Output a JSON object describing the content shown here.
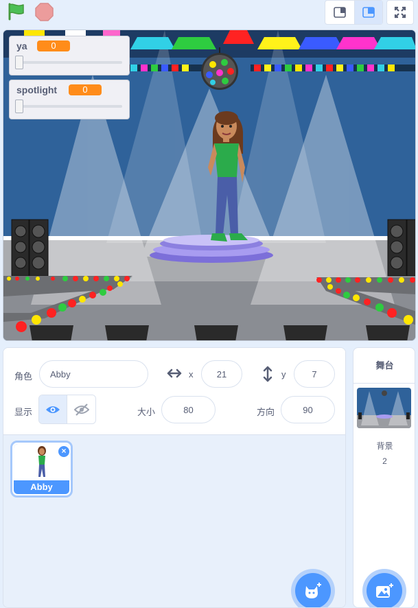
{
  "controls": {
    "flag": "green-flag-icon",
    "stop": "stop-icon",
    "small_stage": "small-stage-icon",
    "normal_stage": "normal-stage-icon",
    "fullscreen": "fullscreen-icon"
  },
  "monitors": [
    {
      "label": "ya",
      "value": "0"
    },
    {
      "label": "spotlight",
      "value": "0"
    }
  ],
  "sprite_info": {
    "sprite_label": "角色",
    "sprite_name": "Abby",
    "x_label": "x",
    "x_value": "21",
    "y_label": "y",
    "y_value": "7",
    "show_label": "显示",
    "size_label": "大小",
    "size_value": "80",
    "direction_label": "方向",
    "direction_value": "90"
  },
  "sprites": [
    {
      "name": "Abby",
      "selected": true,
      "delete": "×"
    }
  ],
  "stage_panel": {
    "title": "舞台",
    "backdrops_label": "背景",
    "backdrop_count": "2"
  },
  "colors": {
    "accent": "#4c97ff",
    "monitor_value": "#ff8c1a",
    "panel_bg": "#e5effc"
  }
}
